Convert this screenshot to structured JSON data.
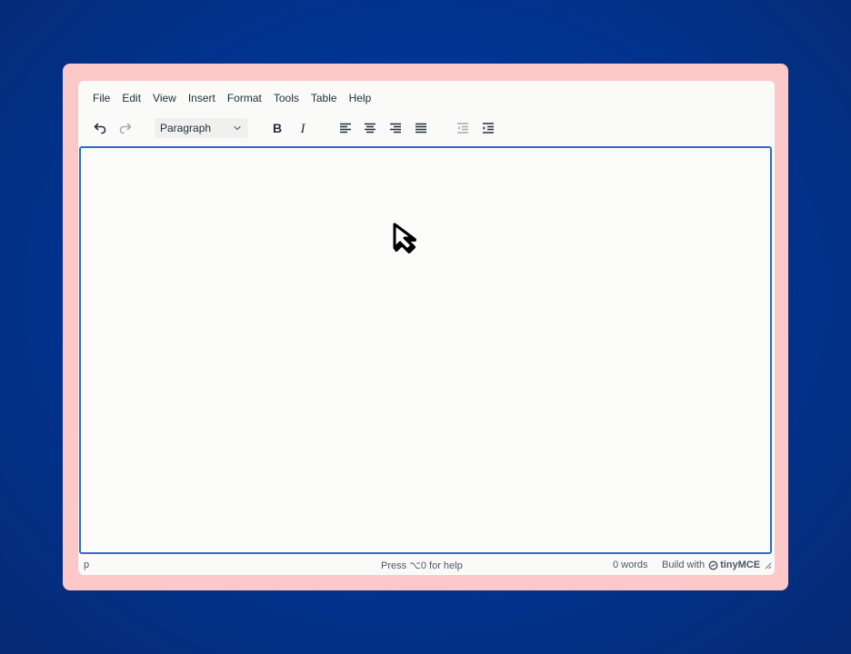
{
  "menubar": {
    "items": [
      "File",
      "Edit",
      "View",
      "Insert",
      "Format",
      "Tools",
      "Table",
      "Help"
    ]
  },
  "toolbar": {
    "undo_icon": "undo-icon",
    "redo_icon": "redo-icon",
    "block_format": "Paragraph",
    "bold_icon": "bold-icon",
    "italic_icon": "italic-icon",
    "align_icons": [
      "align-left-icon",
      "align-center-icon",
      "align-right-icon",
      "align-justify-icon"
    ],
    "indent_icons": [
      "outdent-icon",
      "indent-icon"
    ]
  },
  "content": {
    "text": ""
  },
  "statusbar": {
    "path": "p",
    "help_hint": "Press ⌥0 for help",
    "word_count": "0 words",
    "branding_prefix": "Build with",
    "branding_name": "tinyMCE"
  },
  "colors": {
    "background": "#00338f",
    "frame": "#fcc8c9",
    "editor": "#fafaf9",
    "focus_border": "#2c6ccf",
    "text": "#222f3e"
  }
}
